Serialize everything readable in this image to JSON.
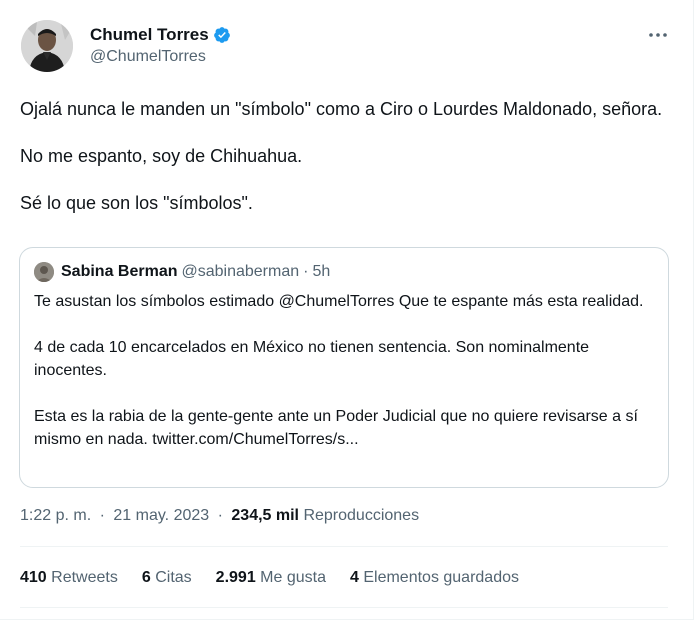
{
  "author": {
    "name": "Chumel Torres",
    "handle": "@ChumelTorres"
  },
  "tweet": {
    "paragraphs": [
      "Ojalá nunca le manden un \"símbolo\" como a Ciro o Lourdes Maldonado, señora.",
      "No me espanto, soy de Chihuahua.",
      "Sé lo que son los \"símbolos\"."
    ]
  },
  "quote": {
    "name": "Sabina Berman",
    "handle": "@sabinaberman",
    "separator": "·",
    "time": "5h",
    "paragraphs": [
      "Te asustan los símbolos estimado @ChumelTorres Que te espante más esta realidad.",
      "4 de cada 10 encarcelados en México no tienen sentencia. Son nominalmente inocentes.",
      "Esta es la rabia de la gente-gente ante un Poder Judicial que no quiere revisarse a sí mismo en nada. twitter.com/ChumelTorres/s..."
    ]
  },
  "meta": {
    "time": "1:22 p. m.",
    "date": "21 may. 2023",
    "separator": "·",
    "views_count": "234,5 mil",
    "views_label": "Reproducciones"
  },
  "stats": {
    "retweets_count": "410",
    "retweets_label": "Retweets",
    "quotes_count": "6",
    "quotes_label": "Citas",
    "likes_count": "2.991",
    "likes_label": "Me gusta",
    "bookmarks_count": "4",
    "bookmarks_label": "Elementos guardados"
  },
  "icons": {
    "verified": "verified-badge-icon",
    "more": "more-options-icon"
  },
  "colors": {
    "verified_blue": "#1d9bf0",
    "secondary_text": "#536471",
    "primary_text": "#0f1419",
    "border": "#cfd9de"
  }
}
